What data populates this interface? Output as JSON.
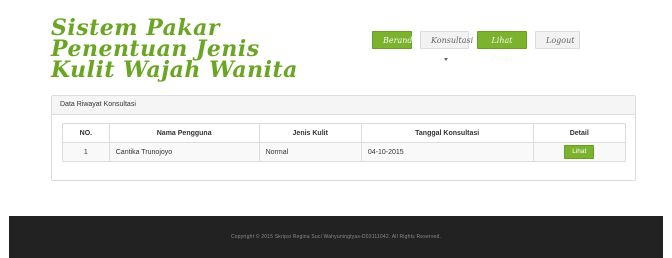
{
  "header": {
    "brand_line1": "Sistem Pakar Penentuan Jenis",
    "brand_line2": "Kulit Wajah Wanita"
  },
  "nav": {
    "items": [
      {
        "label": "Beranda"
      },
      {
        "label": "Konsultasi"
      },
      {
        "label": "Lihat Profil"
      },
      {
        "label": "Logout"
      }
    ]
  },
  "panel": {
    "title": "Data Riwayat Konsultasi",
    "columns": [
      "NO.",
      "Nama Pengguna",
      "Jenis Kulit",
      "Tanggal Konsultasi",
      "Detail"
    ],
    "rows": [
      {
        "no": "1",
        "nama": "Cantika Trunojoyo",
        "jenis": "Normal",
        "tanggal": "04-10-2015",
        "detail_label": "Lihat"
      }
    ]
  },
  "footer": {
    "text": "Copyright © 2015 Skripsi Regina Suci Wahyuningtyas-D03111042. All Rights Reserved."
  },
  "colors": {
    "accent": "#7bb32e",
    "brand": "#6aa623",
    "footer_bg": "#222222"
  }
}
